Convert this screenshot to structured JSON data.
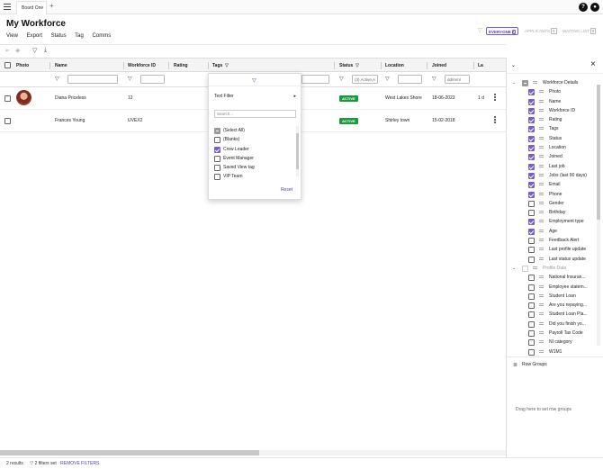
{
  "app": {
    "tab_name": "Board One",
    "tab_add": "+",
    "help_label": "?",
    "profile_label": "●",
    "page_title": "My Workforce",
    "menu": [
      "View",
      "Export",
      "Status",
      "Tag",
      "Comms"
    ]
  },
  "view_toggle": {
    "everyone_label": "EVERYONE",
    "everyone_count": "2",
    "applicants_label": "APPLICANTS",
    "applicants_count": "0",
    "waiting_label": "WAITING LIST",
    "waiting_count": "0"
  },
  "icons": {
    "menu": "hamburger-icon",
    "send": "send-icon",
    "tag": "tag-icon",
    "filter": "filter-icon",
    "download": "download-icon",
    "kebab": "more-vertical-icon"
  },
  "colors": {
    "accent": "#7a5cd0",
    "status_active": "#1a9a3a"
  },
  "grid": {
    "columns": [
      "Photo",
      "Name",
      "Workforce ID",
      "Rating",
      "Tags",
      "Status",
      "Location",
      "Joined",
      "La"
    ],
    "status_filter_value": "(3) Active,A",
    "joined_filter_placeholder": "dd/mm/",
    "rows": [
      {
        "name": "Diana Priceless",
        "workforce_id": "12",
        "status": "ACTIVE",
        "location": "West Lakes Shore",
        "joined": "18-06-2023",
        "last": "1 d"
      },
      {
        "name": "Frances Young",
        "workforce_id": "UVEX2",
        "status": "ACTIVE",
        "location": "Shirley town",
        "joined": "15-02-2018",
        "last": ""
      }
    ]
  },
  "filter_popup": {
    "text_filter_label": "Text Filter",
    "search_placeholder": "Search...",
    "items": [
      {
        "label": "(Select All)",
        "state": "partial"
      },
      {
        "label": "(Blanks)",
        "state": "unchecked"
      },
      {
        "label": "Crew Leader",
        "state": "checked"
      },
      {
        "label": "Event Manager",
        "state": "unchecked"
      },
      {
        "label": "Saved View tag",
        "state": "unchecked"
      },
      {
        "label": "VIP Team",
        "state": "unchecked"
      }
    ],
    "reset_label": "Reset"
  },
  "side_panel": {
    "groups": [
      {
        "label": "Workforce Details",
        "state": "partial",
        "items": [
          {
            "label": "Photo",
            "checked": true
          },
          {
            "label": "Name",
            "checked": true
          },
          {
            "label": "Workforce ID",
            "checked": true
          },
          {
            "label": "Rating",
            "checked": true
          },
          {
            "label": "Tags",
            "checked": true
          },
          {
            "label": "Status",
            "checked": true
          },
          {
            "label": "Location",
            "checked": true
          },
          {
            "label": "Joined",
            "checked": true
          },
          {
            "label": "Last job",
            "checked": true
          },
          {
            "label": "Jobs (last 90 days)",
            "checked": true
          },
          {
            "label": "Email",
            "checked": true
          },
          {
            "label": "Phone",
            "checked": true
          },
          {
            "label": "Gender",
            "checked": false
          },
          {
            "label": "Birthday",
            "checked": false
          },
          {
            "label": "Employment type",
            "checked": true
          },
          {
            "label": "Age",
            "checked": true
          },
          {
            "label": "Feedback Alert",
            "checked": false
          },
          {
            "label": "Last profile update",
            "checked": false
          },
          {
            "label": "Last status update",
            "checked": false
          }
        ]
      },
      {
        "label": "Profile Data",
        "state": "unchecked",
        "items": [
          {
            "label": "National Insuran...",
            "checked": false
          },
          {
            "label": "Employee statem...",
            "checked": false
          },
          {
            "label": "Student Loan",
            "checked": false
          },
          {
            "label": "Are you repaying...",
            "checked": false
          },
          {
            "label": "Student Loan Pla...",
            "checked": false
          },
          {
            "label": "Did you finish yo...",
            "checked": false
          },
          {
            "label": "Payroll Tax Code",
            "checked": false
          },
          {
            "label": "NI category",
            "checked": false
          },
          {
            "label": "W1M1",
            "checked": false
          }
        ]
      }
    ],
    "row_groups_label": "Row Groups",
    "row_groups_hint": "Drag here to set row groups"
  },
  "statusbar": {
    "results": "2 results",
    "filters": "2 filters set",
    "remove_filters": "REMOVE FILTERS"
  }
}
